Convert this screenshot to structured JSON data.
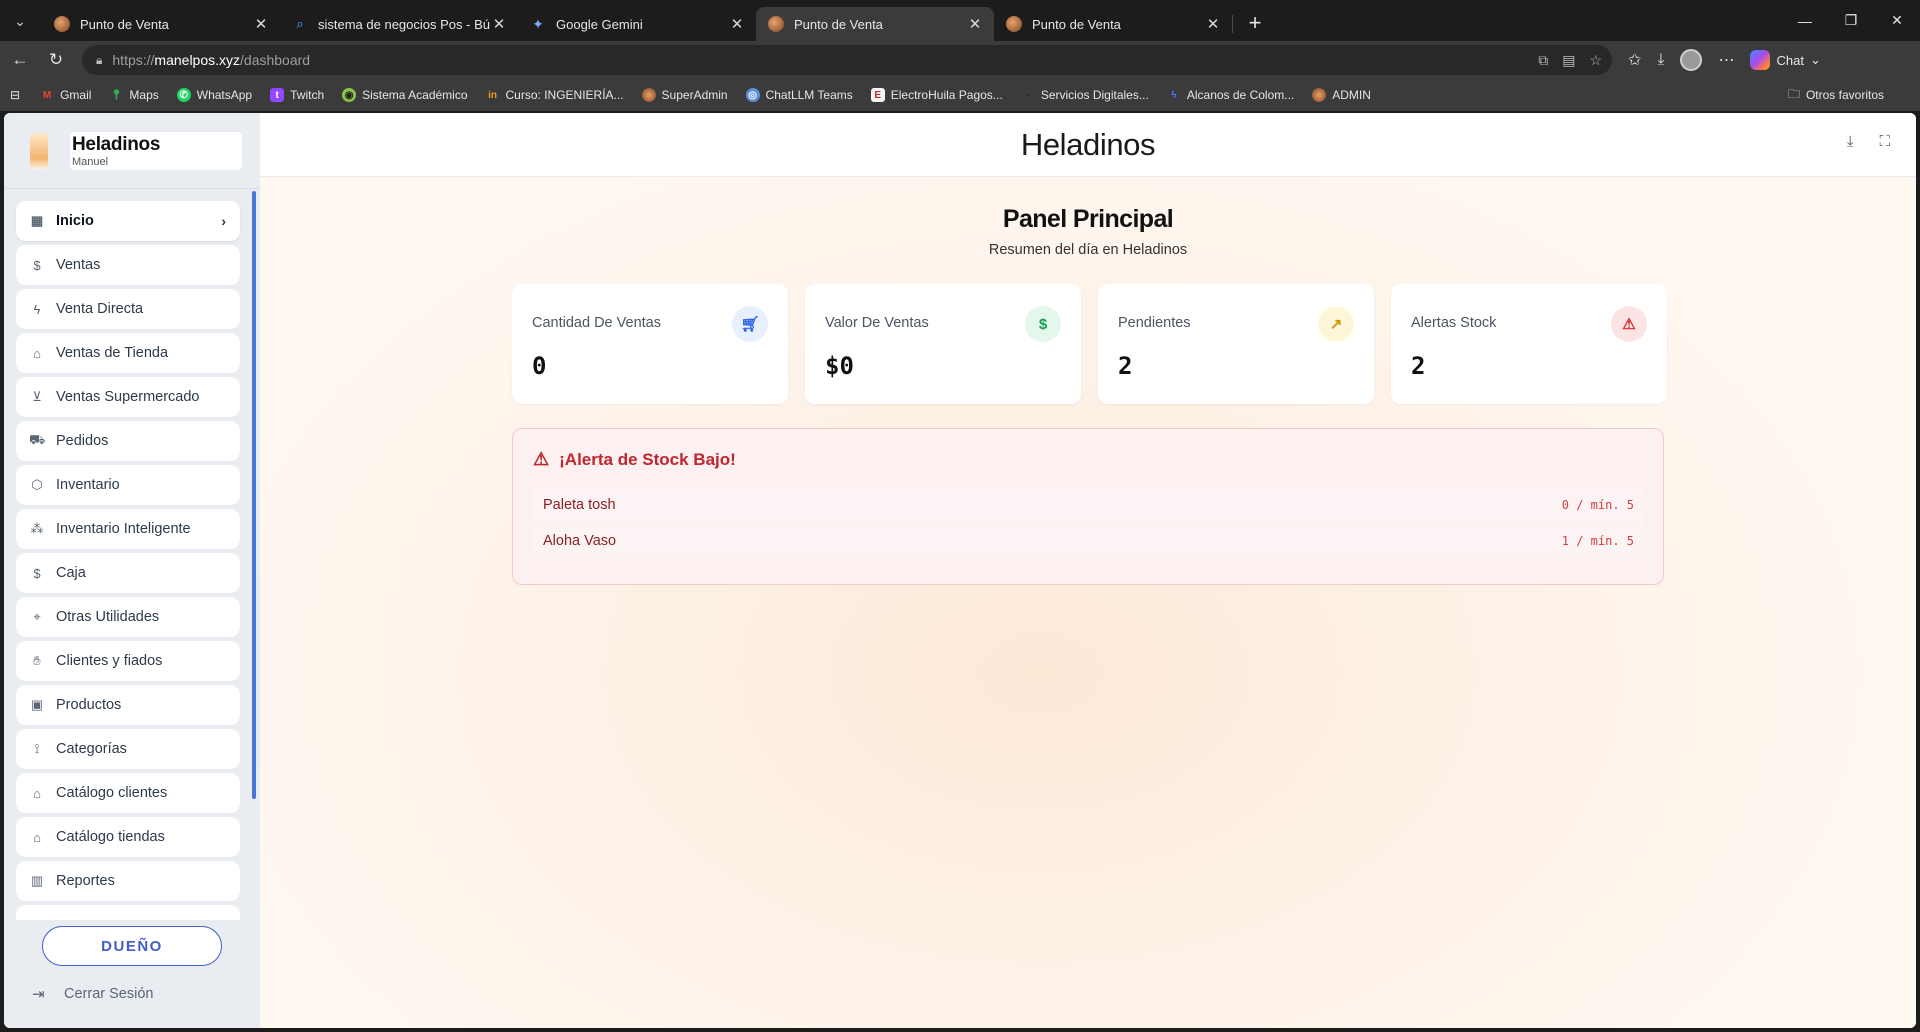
{
  "browser": {
    "tabs": [
      {
        "title": "Punto de Venta",
        "active": false,
        "favicon": "store-icon"
      },
      {
        "title": "sistema de negocios Pos - Búsqueda",
        "active": false,
        "favicon": "search-icon"
      },
      {
        "title": "Google Gemini",
        "active": false,
        "favicon": "gemini-icon"
      },
      {
        "title": "Punto de Venta",
        "active": true,
        "favicon": "store-icon"
      },
      {
        "title": "Punto de Venta",
        "active": false,
        "favicon": "store-icon"
      }
    ],
    "url": {
      "protocol": "https://",
      "host": "manelpos.xyz",
      "path": "/dashboard"
    },
    "chat_label": "Chat",
    "bookmarks": [
      {
        "label": "Gmail"
      },
      {
        "label": "Maps"
      },
      {
        "label": "WhatsApp"
      },
      {
        "label": "Twitch"
      },
      {
        "label": "Sistema Académico"
      },
      {
        "label": "Curso: INGENIERÍA..."
      },
      {
        "label": "SuperAdmin"
      },
      {
        "label": "ChatLLM Teams"
      },
      {
        "label": "ElectroHuila Pagos..."
      },
      {
        "label": "Servicios Digitales..."
      },
      {
        "label": "Alcanos de Colom..."
      },
      {
        "label": "ADMIN"
      }
    ],
    "other_favorites": "Otros favoritos"
  },
  "sidebar": {
    "business_name": "Heladinos",
    "user_name": "Manuel",
    "items": [
      {
        "label": "Inicio",
        "icon": "grid-icon",
        "active": true
      },
      {
        "label": "Ventas",
        "icon": "dollar-receipt-icon"
      },
      {
        "label": "Venta Directa",
        "icon": "lightning-icon"
      },
      {
        "label": "Ventas de Tienda",
        "icon": "store-icon"
      },
      {
        "label": "Ventas Supermercado",
        "icon": "basket-icon"
      },
      {
        "label": "Pedidos",
        "icon": "cart-icon"
      },
      {
        "label": "Inventario",
        "icon": "box-icon"
      },
      {
        "label": "Inventario Inteligente",
        "icon": "network-icon"
      },
      {
        "label": "Caja",
        "icon": "dollar-icon"
      },
      {
        "label": "Otras Utilidades",
        "icon": "tag-icon"
      },
      {
        "label": "Clientes y fiados",
        "icon": "hand-coins-icon"
      },
      {
        "label": "Productos",
        "icon": "package-icon"
      },
      {
        "label": "Categorías",
        "icon": "tags-icon"
      },
      {
        "label": "Catálogo clientes",
        "icon": "store-icon"
      },
      {
        "label": "Catálogo tiendas",
        "icon": "store-icon"
      },
      {
        "label": "Reportes",
        "icon": "bar-chart-icon"
      }
    ],
    "role_label": "DUEÑO",
    "logout_label": "Cerrar Sesión"
  },
  "header": {
    "title": "Heladinos"
  },
  "dashboard": {
    "title": "Panel Principal",
    "subtitle": "Resumen del día en Heladinos",
    "cards": [
      {
        "label": "Cantidad De Ventas",
        "value": "0",
        "icon": "cart-icon",
        "color": "#3167e8"
      },
      {
        "label": "Valor De Ventas",
        "value": "$0",
        "icon": "dollar-icon",
        "color": "#15a34a"
      },
      {
        "label": "Pendientes",
        "value": "2",
        "icon": "trending-up-icon",
        "color": "#c89a05"
      },
      {
        "label": "Alertas Stock",
        "value": "2",
        "icon": "warning-icon",
        "color": "#dc2626"
      }
    ],
    "stock_alert": {
      "title": "¡Alerta de Stock Bajo!",
      "items": [
        {
          "name": "Paleta tosh",
          "stock": "0 / mín. 5"
        },
        {
          "name": "Aloha Vaso",
          "stock": "1 / mín. 5"
        }
      ]
    }
  }
}
